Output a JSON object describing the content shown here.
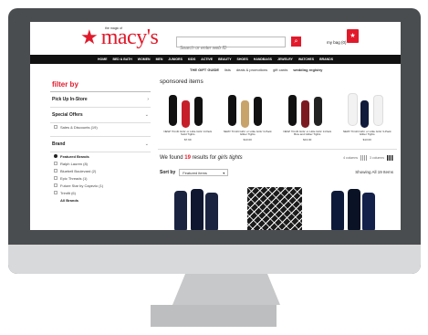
{
  "header": {
    "logo_tagline": "the magic of",
    "logo_word": "macy's",
    "search_placeholder": "Search or enter web ID",
    "bag_label": "my bag (0)"
  },
  "nav": [
    "HOME",
    "BED & BATH",
    "WOMEN",
    "MEN",
    "JUNIORS",
    "KIDS",
    "ACTIVE",
    "BEAUTY",
    "SHOES",
    "HANDBAGS",
    "JEWELRY",
    "WATCHES",
    "BRANDS"
  ],
  "subnav": {
    "gift_guide": "THE GIFT GUIDE",
    "lists": "lists",
    "deals": "deals & promotions",
    "gift_cards": "gift cards",
    "wedding": "wedding registry"
  },
  "sidebar": {
    "title": "filter by",
    "pickup": "Pick Up In-Store",
    "special_offers": "Special Offers",
    "sales": "Sales & Discounts (19)",
    "brand": "Brand",
    "featured": "Featured Brands",
    "brands": [
      "Ralph Lauren (8)",
      "Bluebell Boulevard (2)",
      "Epic Threads (1)",
      "Future Star by Capezio (1)",
      "Trimfit (6)"
    ],
    "all_brands": "All Brands"
  },
  "main": {
    "sponsored": "sponsored items",
    "results_prefix": "We found ",
    "results_count": "19",
    "results_mid": " results for ",
    "results_query": "girls tights",
    "cols4": "4 columns",
    "cols3": "3 columns",
    "sort_label": "Sort by",
    "sort_value": "Featured items",
    "showing": "Showing All 19 Items"
  },
  "products": [
    {
      "name": "NEW! Trimfit Girls' or Little Girls' 3-Pack Solid Tights",
      "price": "$7.99",
      "legs": [
        "#111111",
        "#c61f2a",
        "#111111"
      ]
    },
    {
      "name": "NEW! Trimfit Girls' or Little Girls' 3-Pack Glitter Tights",
      "price": "$13.00",
      "legs": [
        "#111111",
        "#c8a36a",
        "#111111"
      ]
    },
    {
      "name": "NEW! Trimfit Girls' or Little Girls' 3-Pack Bow and Glitter Tights",
      "price": "$13.00",
      "legs": [
        "#111111",
        "#7c1a22",
        "#222222"
      ]
    },
    {
      "name": "NEW! Trimfit Girls' or Little Girls' 3-Pack Glitter Tights",
      "price": "$13.00",
      "legs": [
        "#f2f2f2",
        "#101a3a",
        "#f2f2f2"
      ]
    }
  ],
  "colors": {
    "brand_red": "#e11a2b",
    "nav_bg": "#111111",
    "bezel": "#4a4d50"
  }
}
